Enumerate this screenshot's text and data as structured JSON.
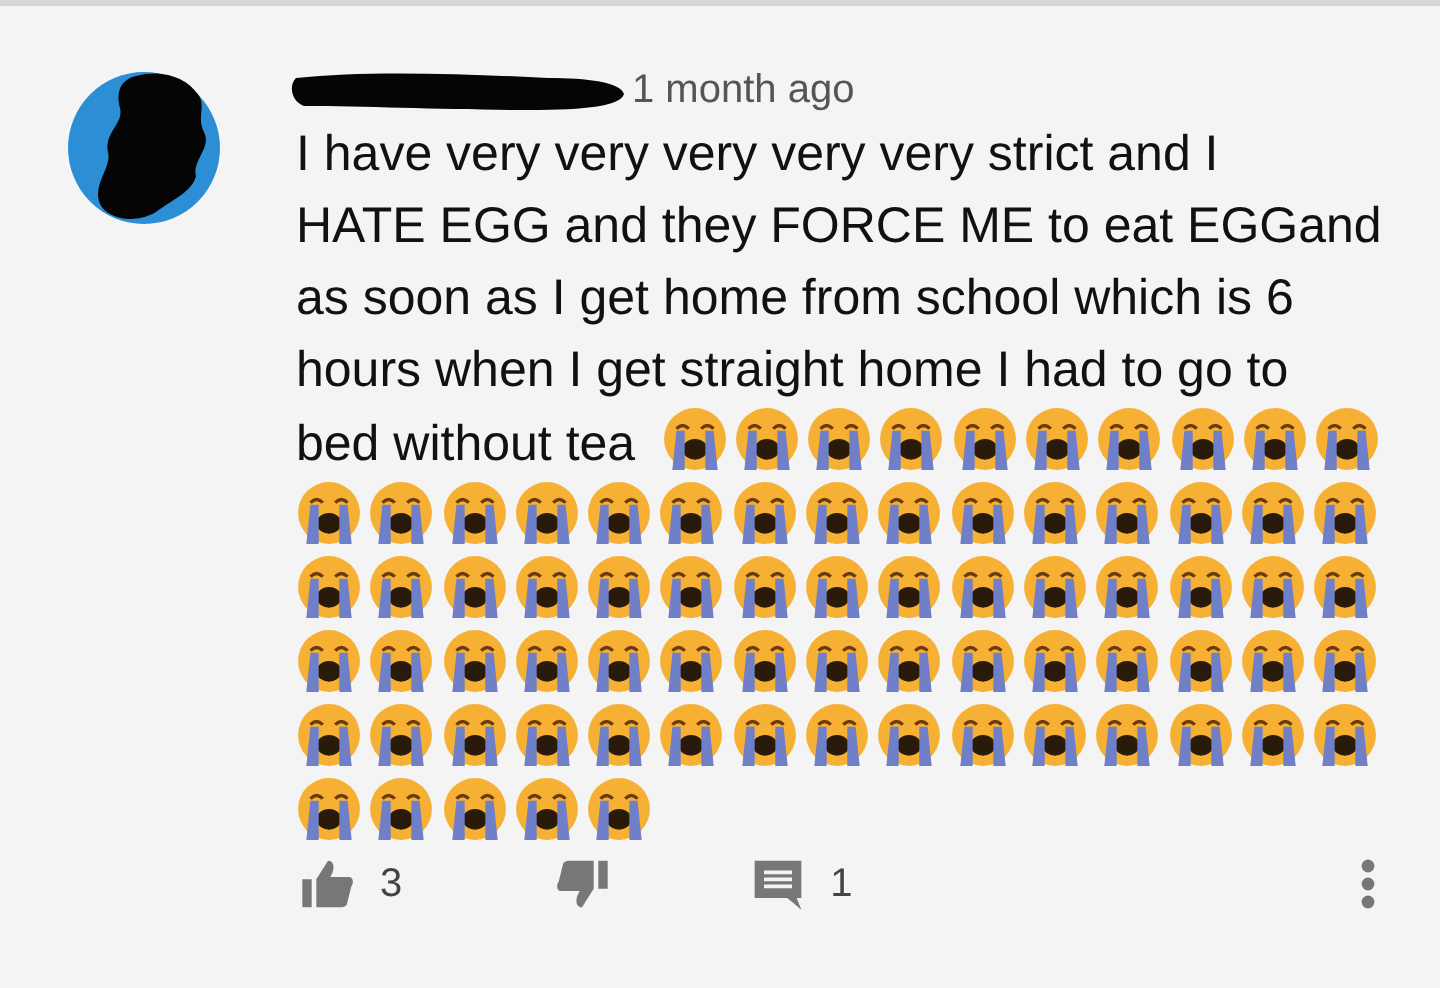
{
  "comment": {
    "time": "1 month ago",
    "text_lines": [
      "I have very very very very very strict and I",
      "HATE EGG and they FORCE ME to eat EGGand",
      "as soon as I get home from school which is 6",
      "hours when I get straight home I had to go to",
      "bed without tea"
    ],
    "emoji": [
      {
        "kind": "loudly-crying"
      },
      {
        "kind": "loudly-crying"
      },
      {
        "kind": "loudly-crying"
      },
      {
        "kind": "loudly-crying"
      },
      {
        "kind": "loudly-crying"
      },
      {
        "kind": "loudly-crying"
      },
      {
        "kind": "loudly-crying"
      },
      {
        "kind": "loudly-crying"
      },
      {
        "kind": "loudly-crying"
      },
      {
        "kind": "loudly-crying"
      },
      {
        "kind": "loudly-crying"
      },
      {
        "kind": "loudly-crying"
      },
      {
        "kind": "loudly-crying"
      },
      {
        "kind": "loudly-crying"
      },
      {
        "kind": "loudly-crying"
      },
      {
        "kind": "loudly-crying"
      },
      {
        "kind": "loudly-crying"
      },
      {
        "kind": "loudly-crying"
      },
      {
        "kind": "loudly-crying"
      },
      {
        "kind": "loudly-crying"
      },
      {
        "kind": "loudly-crying"
      },
      {
        "kind": "loudly-crying"
      },
      {
        "kind": "loudly-crying"
      },
      {
        "kind": "loudly-crying"
      },
      {
        "kind": "loudly-crying"
      },
      {
        "kind": "loudly-crying"
      },
      {
        "kind": "loudly-crying"
      },
      {
        "kind": "loudly-crying"
      },
      {
        "kind": "loudly-crying"
      },
      {
        "kind": "loudly-crying"
      },
      {
        "kind": "loudly-crying"
      },
      {
        "kind": "loudly-crying"
      },
      {
        "kind": "loudly-crying"
      },
      {
        "kind": "loudly-crying"
      },
      {
        "kind": "loudly-crying"
      },
      {
        "kind": "loudly-crying"
      },
      {
        "kind": "loudly-crying"
      },
      {
        "kind": "loudly-crying"
      },
      {
        "kind": "loudly-crying"
      },
      {
        "kind": "loudly-crying"
      },
      {
        "kind": "loudly-crying"
      },
      {
        "kind": "loudly-crying"
      },
      {
        "kind": "loudly-crying"
      },
      {
        "kind": "loudly-crying"
      },
      {
        "kind": "loudly-crying"
      },
      {
        "kind": "loudly-crying"
      },
      {
        "kind": "loudly-crying"
      },
      {
        "kind": "loudly-crying"
      },
      {
        "kind": "loudly-crying"
      },
      {
        "kind": "loudly-crying"
      },
      {
        "kind": "loudly-crying"
      },
      {
        "kind": "loudly-crying"
      },
      {
        "kind": "loudly-crying"
      },
      {
        "kind": "loudly-crying"
      },
      {
        "kind": "loudly-crying"
      },
      {
        "kind": "loudly-crying"
      },
      {
        "kind": "loudly-crying"
      },
      {
        "kind": "loudly-crying"
      },
      {
        "kind": "loudly-crying"
      },
      {
        "kind": "loudly-crying"
      },
      {
        "kind": "loudly-crying"
      },
      {
        "kind": "loudly-crying"
      },
      {
        "kind": "loudly-crying"
      },
      {
        "kind": "loudly-crying"
      },
      {
        "kind": "loudly-crying"
      },
      {
        "kind": "loudly-crying"
      },
      {
        "kind": "loudly-crying"
      },
      {
        "kind": "loudly-crying"
      },
      {
        "kind": "loudly-crying"
      },
      {
        "kind": "loudly-crying"
      },
      {
        "kind": "loudly-crying"
      },
      {
        "kind": "loudly-crying"
      },
      {
        "kind": "loudly-crying"
      },
      {
        "kind": "loudly-crying"
      },
      {
        "kind": "loudly-crying"
      }
    ],
    "likes": "3",
    "replies": "1"
  }
}
